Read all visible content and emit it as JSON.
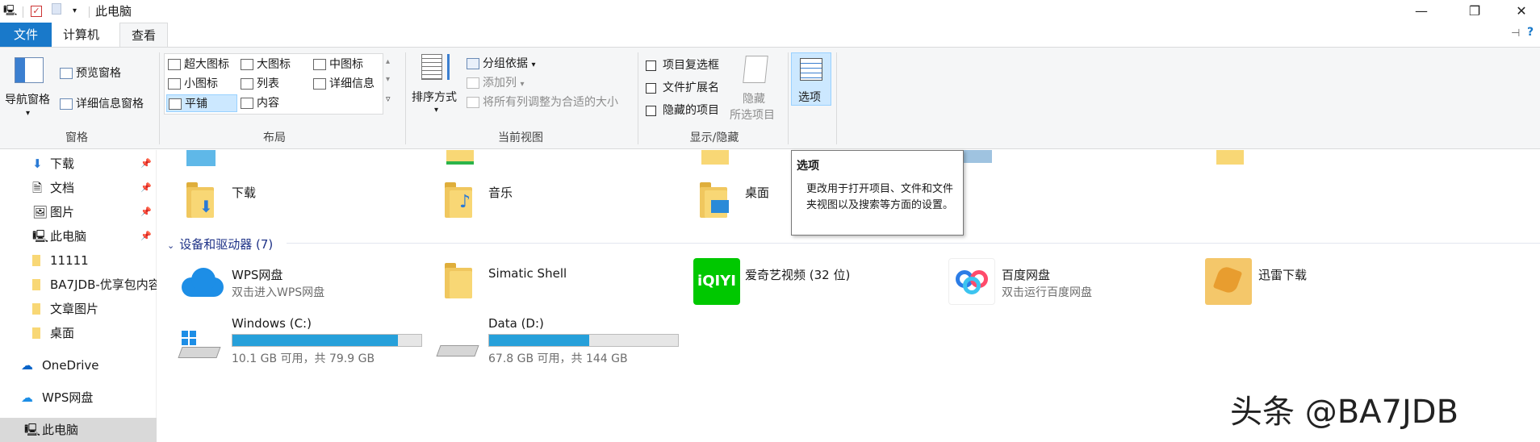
{
  "window": {
    "title": "此电脑",
    "buttons": {
      "minimize": "—",
      "maximize": "❐",
      "close": "✕"
    }
  },
  "tabs": {
    "file": "文件",
    "computer": "计算机",
    "view": "查看"
  },
  "ribbon": {
    "panes": {
      "nav_pane": "导航窗格",
      "preview_pane": "预览窗格",
      "details_pane": "详细信息窗格",
      "label": "窗格"
    },
    "layout": {
      "items": [
        "超大图标",
        "大图标",
        "中图标",
        "小图标",
        "列表",
        "详细信息",
        "平铺",
        "内容"
      ],
      "selected": "平铺",
      "label": "布局"
    },
    "current_view": {
      "sort_by": "排序方式",
      "group_by": "分组依据",
      "add_columns": "添加列",
      "size_all_columns": "将所有列调整为合适的大小",
      "label": "当前视图"
    },
    "show_hide": {
      "item_checkboxes": "项目复选框",
      "file_extensions": "文件扩展名",
      "hidden_items": "隐藏的项目",
      "hide_selected_1": "隐藏",
      "hide_selected_2": "所选项目",
      "label": "显示/隐藏"
    },
    "options": "选项"
  },
  "nav": {
    "items": [
      {
        "label": "下载",
        "pinned": true
      },
      {
        "label": "文档",
        "pinned": true
      },
      {
        "label": "图片",
        "pinned": true
      },
      {
        "label": "此电脑",
        "pinned": true
      },
      {
        "label": "11111"
      },
      {
        "label": "BA7JDB-优享包内容"
      },
      {
        "label": "文章图片"
      },
      {
        "label": "桌面"
      },
      {
        "label": "OneDrive"
      },
      {
        "label": "WPS网盘"
      },
      {
        "label": "此电脑"
      }
    ]
  },
  "folders": [
    {
      "label": "下载"
    },
    {
      "label": "音乐"
    },
    {
      "label": "桌面"
    }
  ],
  "devices": {
    "heading": "设备和驱动器 (7)",
    "items": [
      {
        "label": "WPS网盘",
        "sub": "双击进入WPS网盘"
      },
      {
        "label": "Simatic Shell",
        "sub": ""
      },
      {
        "label": "爱奇艺视频 (32 位)",
        "sub": ""
      },
      {
        "label": "百度网盘",
        "sub": "双击运行百度网盘"
      },
      {
        "label": "迅雷下载",
        "sub": ""
      }
    ],
    "iqiyi_logo": "iQIYI",
    "drives": [
      {
        "label": "Windows (C:)",
        "sub": "10.1 GB 可用，共 79.9 GB",
        "used_fraction": 0.874
      },
      {
        "label": "Data (D:)",
        "sub": "67.8 GB 可用，共 144 GB",
        "used_fraction": 0.529
      }
    ]
  },
  "tooltip": {
    "title": "选项",
    "body": "更改用于打开项目、文件和文件夹视图以及搜索等方面的设置。"
  },
  "watermark": "头条 @BA7JDB",
  "colors": {
    "accent": "#1979ca",
    "drive_fill": "#26a0da",
    "selection": "#cce8ff"
  }
}
